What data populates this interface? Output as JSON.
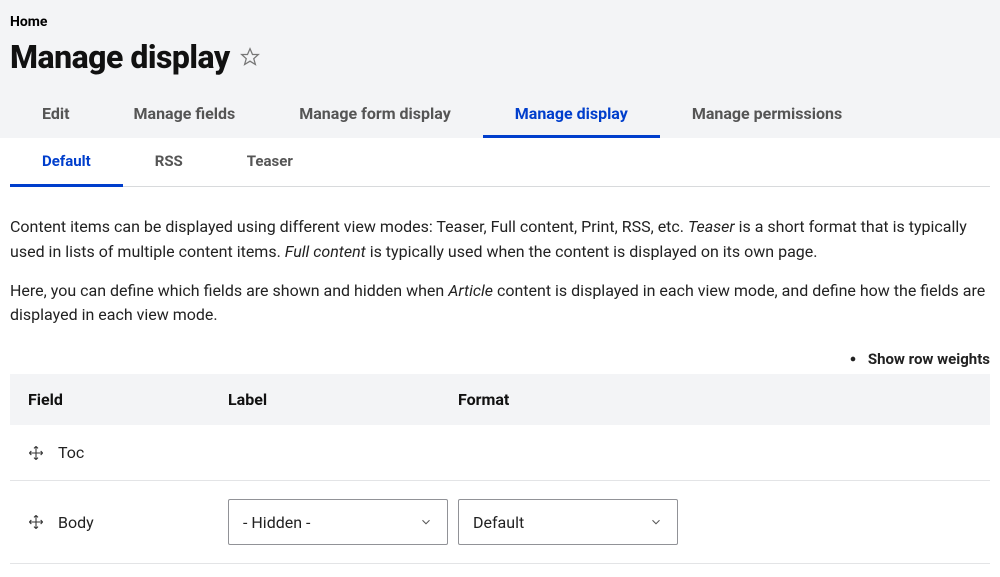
{
  "breadcrumb": "Home",
  "page_title": "Manage display",
  "main_tabs": [
    {
      "label": "Edit",
      "active": false
    },
    {
      "label": "Manage fields",
      "active": false
    },
    {
      "label": "Manage form display",
      "active": false
    },
    {
      "label": "Manage display",
      "active": true
    },
    {
      "label": "Manage permissions",
      "active": false
    }
  ],
  "sub_tabs": [
    {
      "label": "Default",
      "active": true
    },
    {
      "label": "RSS",
      "active": false
    },
    {
      "label": "Teaser",
      "active": false
    }
  ],
  "intro": {
    "p1_a": "Content items can be displayed using different view modes: Teaser, Full content, Print, RSS, etc. ",
    "p1_em1": "Teaser",
    "p1_b": " is a short format that is typically used in lists of multiple content items. ",
    "p1_em2": "Full content",
    "p1_c": " is typically used when the content is displayed on its own page.",
    "p2_a": "Here, you can define which fields are shown and hidden when ",
    "p2_em1": "Article",
    "p2_b": " content is displayed in each view mode, and define how the fields are displayed in each view mode."
  },
  "show_row_weights": "Show row weights",
  "columns": {
    "field": "Field",
    "label": "Label",
    "format": "Format"
  },
  "rows": [
    {
      "field": "Toc",
      "label_select": null,
      "format_select": null
    },
    {
      "field": "Body",
      "label_select": "- Hidden -",
      "format_select": "Default"
    }
  ]
}
